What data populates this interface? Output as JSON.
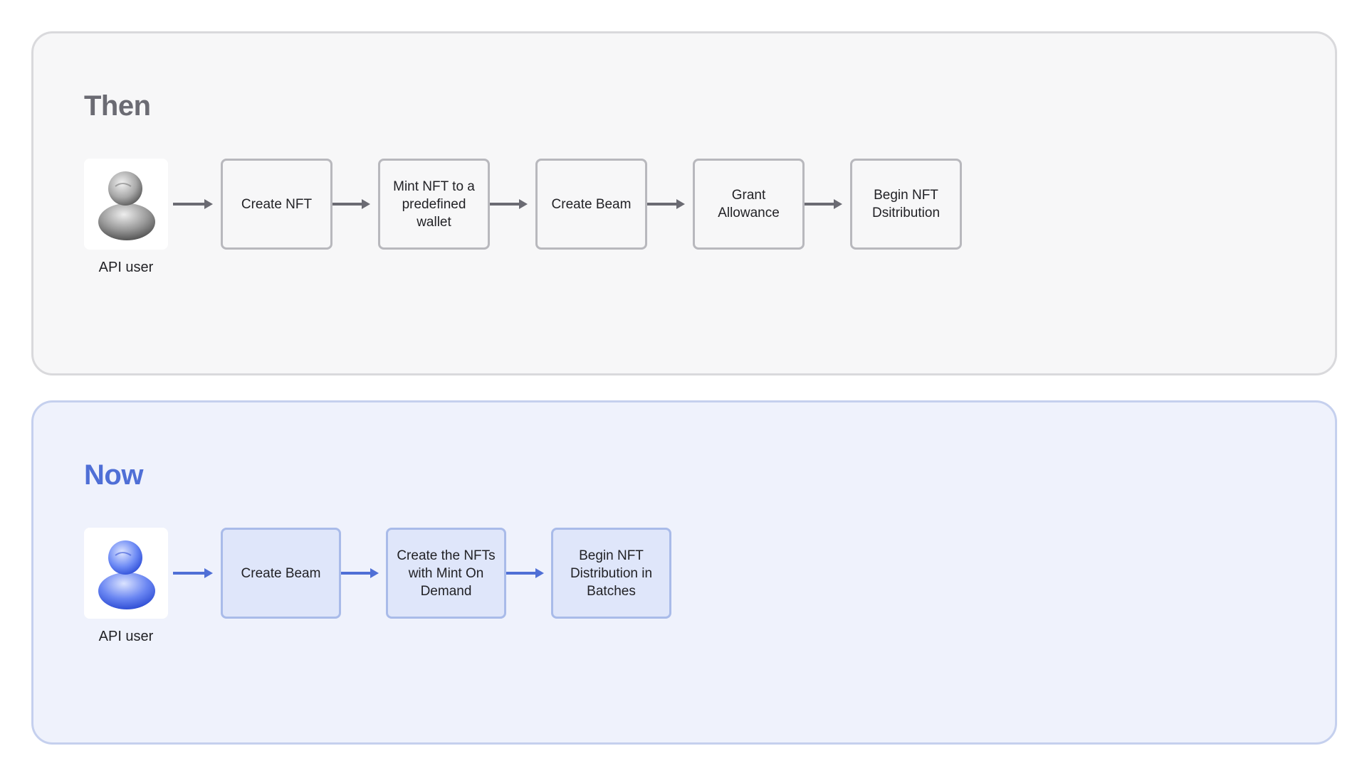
{
  "then": {
    "title": "Then",
    "user_label": "API user",
    "steps": [
      {
        "label": "Create NFT"
      },
      {
        "label": "Mint NFT to a predefined wallet"
      },
      {
        "label": "Create Beam"
      },
      {
        "label": "Grant Allowance"
      },
      {
        "label": "Begin NFT Dsitribution"
      }
    ],
    "accent": "#6b6b73"
  },
  "now": {
    "title": "Now",
    "user_label": "API user",
    "steps": [
      {
        "label": "Create Beam"
      },
      {
        "label": "Create the NFTs with Mint On Demand"
      },
      {
        "label": "Begin NFT Distribution in Batches"
      }
    ],
    "accent": "#4f6fd6"
  },
  "icons": {
    "user": "user-avatar-icon",
    "arrow": "arrow-right-icon"
  }
}
